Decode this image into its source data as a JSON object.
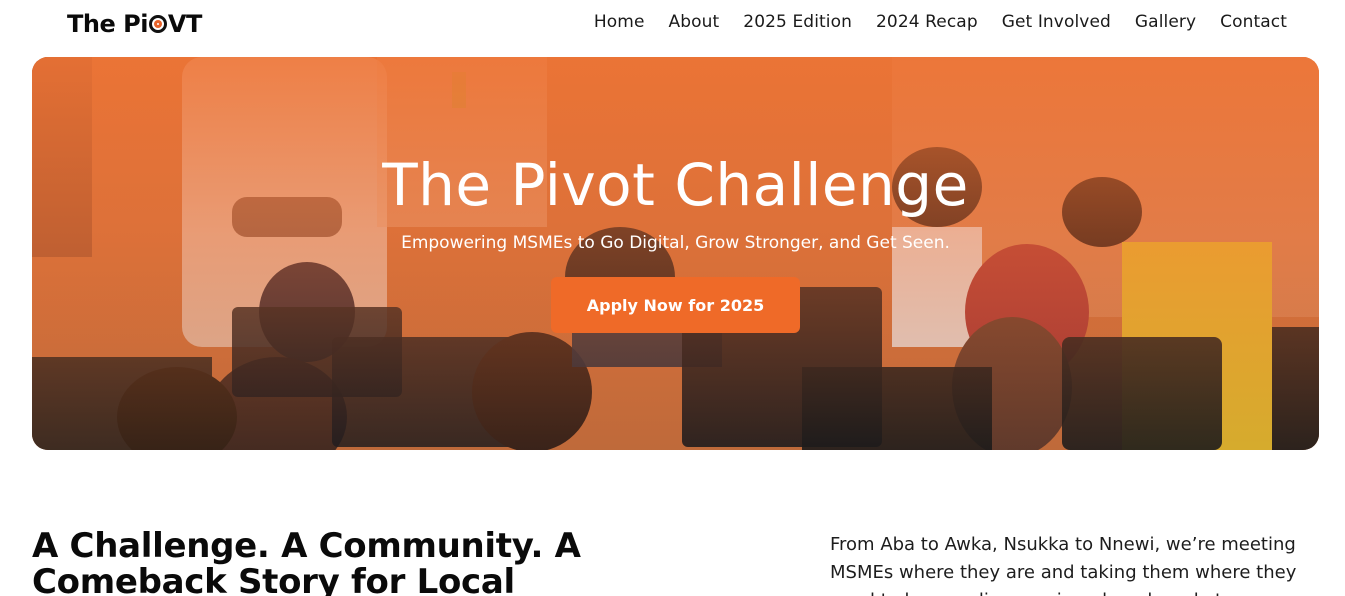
{
  "header": {
    "logo_text_1": "The P",
    "logo_text_2": "i",
    "logo_text_3": "V",
    "logo_text_4": "T",
    "nav": [
      {
        "label": "Home"
      },
      {
        "label": "About"
      },
      {
        "label": "2025 Edition"
      },
      {
        "label": "2024 Recap"
      },
      {
        "label": "Get Involved"
      },
      {
        "label": "Gallery"
      },
      {
        "label": "Contact"
      }
    ]
  },
  "hero": {
    "title": "The Pivot Challenge",
    "subtitle": "Empowering MSMEs to Go Digital, Grow Stronger, and Get Seen.",
    "cta_label": "Apply Now for 2025"
  },
  "intro": {
    "heading": "A Challenge. A Community. A Comeback Story for Local",
    "text": "From Aba to Awka, Nsukka to Nnewi, we’re meeting MSMEs where they are and taking them where they need to be — online, equipped, and ready to grow."
  },
  "colors": {
    "accent": "#ef6a28",
    "text": "#0a0a0a"
  }
}
